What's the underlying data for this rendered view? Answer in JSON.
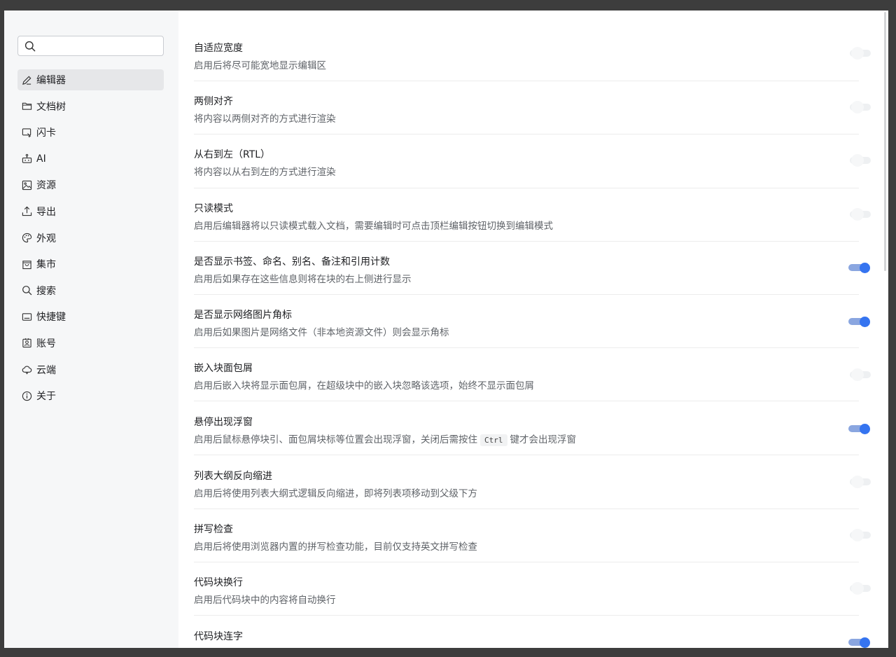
{
  "search": {
    "placeholder": "",
    "value": ""
  },
  "sidebar": {
    "items": [
      {
        "label": "编辑器",
        "icon": "edit-icon",
        "active": true
      },
      {
        "label": "文档树",
        "icon": "folder-icon",
        "active": false
      },
      {
        "label": "闪卡",
        "icon": "flashcard-icon",
        "active": false
      },
      {
        "label": "AI",
        "icon": "robot-icon",
        "active": false
      },
      {
        "label": "资源",
        "icon": "image-icon",
        "active": false
      },
      {
        "label": "导出",
        "icon": "upload-icon",
        "active": false
      },
      {
        "label": "外观",
        "icon": "palette-icon",
        "active": false
      },
      {
        "label": "集市",
        "icon": "bag-icon",
        "active": false
      },
      {
        "label": "搜索",
        "icon": "search-icon",
        "active": false
      },
      {
        "label": "快捷键",
        "icon": "keyboard-icon",
        "active": false
      },
      {
        "label": "账号",
        "icon": "account-icon",
        "active": false
      },
      {
        "label": "云端",
        "icon": "cloud-icon",
        "active": false
      },
      {
        "label": "关于",
        "icon": "info-icon",
        "active": false
      }
    ]
  },
  "settings": [
    {
      "title": "自适应宽度",
      "desc": "启用后将尽可能宽地显示编辑区",
      "enabled": false
    },
    {
      "title": "两侧对齐",
      "desc": "将内容以两侧对齐的方式进行渲染",
      "enabled": false
    },
    {
      "title": "从右到左（RTL）",
      "desc": "将内容以从右到左的方式进行渲染",
      "enabled": false
    },
    {
      "title": "只读模式",
      "desc": "启用后编辑器将以只读模式载入文档，需要编辑时可点击顶栏编辑按钮切换到编辑模式",
      "enabled": false
    },
    {
      "title": "是否显示书签、命名、别名、备注和引用计数",
      "desc": "启用后如果存在这些信息则将在块的右上侧进行显示",
      "enabled": true
    },
    {
      "title": "是否显示网络图片角标",
      "desc": "启用后如果图片是网络文件（非本地资源文件）则会显示角标",
      "enabled": true
    },
    {
      "title": "嵌入块面包屑",
      "desc": "启用后嵌入块将显示面包屑，在超级块中的嵌入块忽略该选项，始终不显示面包屑",
      "enabled": false
    },
    {
      "title": "悬停出现浮窗",
      "desc_before": "启用后鼠标悬停块引、面包屑块标等位置会出现浮窗，关闭后需按住",
      "desc_code": "Ctrl",
      "desc_after": "键才会出现浮窗",
      "enabled": true
    },
    {
      "title": "列表大纲反向缩进",
      "desc": "启用后将使用列表大纲式逻辑反向缩进，即将列表项移动到父级下方",
      "enabled": false
    },
    {
      "title": "拼写检查",
      "desc": "启用后将使用浏览器内置的拼写检查功能，目前仅支持英文拼写检查",
      "enabled": false
    },
    {
      "title": "代码块换行",
      "desc": "启用后代码块中的内容将自动换行",
      "enabled": false
    },
    {
      "title": "代码块连字",
      "desc": "",
      "enabled": true
    }
  ],
  "colors": {
    "accent": "#3574f0",
    "sidebar_bg": "#f6f7f8",
    "backdrop": "#3d3d3d"
  }
}
